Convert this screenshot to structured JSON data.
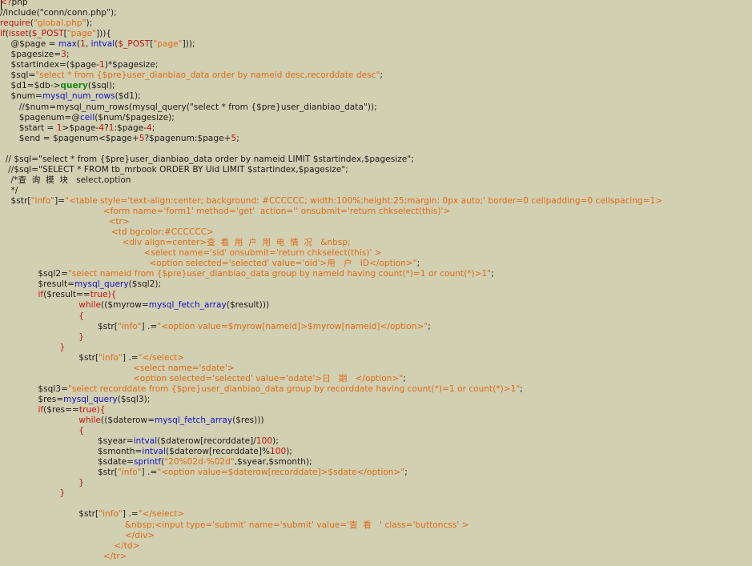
{
  "editor": {
    "background_color": "#d2d0b2",
    "colors": {
      "keyword": "#c81010",
      "function": "#1010c8",
      "string": "#e06a14",
      "plain": "#1a1a1a",
      "method": "#168a16"
    },
    "lines": [
      [
        {
          "t": "<?",
          "c": "phptag"
        },
        {
          "t": "php",
          "c": "plain"
        }
      ],
      [
        {
          "t": "//include(\"conn/conn.php\");",
          "c": "plain"
        }
      ],
      [
        {
          "t": "require",
          "c": "kw"
        },
        {
          "t": "(",
          "c": "plain"
        },
        {
          "t": "\"global.php\"",
          "c": "str"
        },
        {
          "t": ");",
          "c": "plain"
        }
      ],
      [
        {
          "t": "if",
          "c": "kw"
        },
        {
          "t": "(",
          "c": "plain"
        },
        {
          "t": "isset",
          "c": "kw"
        },
        {
          "t": "(",
          "c": "plain"
        },
        {
          "t": "$_POST",
          "c": "kw"
        },
        {
          "t": "[",
          "c": "plain"
        },
        {
          "t": "\"page\"",
          "c": "str"
        },
        {
          "t": "])){",
          "c": "plain"
        }
      ],
      [
        {
          "t": "    @$page = ",
          "c": "plain"
        },
        {
          "t": "max",
          "c": "fn"
        },
        {
          "t": "(",
          "c": "plain"
        },
        {
          "t": "1",
          "c": "num"
        },
        {
          "t": ", ",
          "c": "plain"
        },
        {
          "t": "intval",
          "c": "fn"
        },
        {
          "t": "(",
          "c": "plain"
        },
        {
          "t": "$_POST",
          "c": "kw"
        },
        {
          "t": "[",
          "c": "plain"
        },
        {
          "t": "\"page\"",
          "c": "str"
        },
        {
          "t": "]));",
          "c": "plain"
        }
      ],
      [
        {
          "t": "    $pagesize=",
          "c": "plain"
        },
        {
          "t": "3",
          "c": "num"
        },
        {
          "t": ";",
          "c": "plain"
        }
      ],
      [
        {
          "t": "    $startindex=($page-",
          "c": "plain"
        },
        {
          "t": "1",
          "c": "num"
        },
        {
          "t": ")*$pagesize;",
          "c": "plain"
        }
      ],
      [
        {
          "t": "    $sql=",
          "c": "plain"
        },
        {
          "t": "\"select * from {$pre}user_dianbiao_data order by nameid desc,recorddate desc\"",
          "c": "str"
        },
        {
          "t": ";",
          "c": "plain"
        }
      ],
      [
        {
          "t": "    $d1=$db->",
          "c": "plain"
        },
        {
          "t": "query",
          "c": "method"
        },
        {
          "t": "($sql);",
          "c": "plain"
        }
      ],
      [
        {
          "t": "    $num=",
          "c": "plain"
        },
        {
          "t": "mysql_num_rows",
          "c": "fn"
        },
        {
          "t": "($d1);",
          "c": "plain"
        }
      ],
      [
        {
          "t": "       //$num=mysql_num_rows(mysql_query(\"select * from {$pre}user_dianbiao_data\"));",
          "c": "plain"
        }
      ],
      [
        {
          "t": "       $pagenum=@",
          "c": "plain"
        },
        {
          "t": "ceil",
          "c": "fn"
        },
        {
          "t": "($num/$pagesize);",
          "c": "plain"
        }
      ],
      [
        {
          "t": "       $start = ",
          "c": "plain"
        },
        {
          "t": "1",
          "c": "num"
        },
        {
          "t": ">$page-",
          "c": "plain"
        },
        {
          "t": "4",
          "c": "num"
        },
        {
          "t": "?",
          "c": "plain"
        },
        {
          "t": "1",
          "c": "num"
        },
        {
          "t": ":$page-",
          "c": "plain"
        },
        {
          "t": "4",
          "c": "num"
        },
        {
          "t": ";",
          "c": "plain"
        }
      ],
      [
        {
          "t": "       $end = $pagenum<$page+",
          "c": "plain"
        },
        {
          "t": "5",
          "c": "num"
        },
        {
          "t": "?$pagenum:$page+",
          "c": "plain"
        },
        {
          "t": "5",
          "c": "num"
        },
        {
          "t": ";",
          "c": "plain"
        }
      ],
      [
        {
          "t": "",
          "c": "plain"
        }
      ],
      [
        {
          "t": "  // $sql=\"select * from {$pre}user_dianbiao_data order by nameid LIMIT $startindex,$pagesize\";",
          "c": "plain"
        }
      ],
      [
        {
          "t": "   //$sql=\"SELECT * FROM tb_mrbook ORDER BY Uid LIMIT $startindex,$pagesize\";",
          "c": "plain"
        }
      ],
      [
        {
          "t": "    /*查  询  模  块   select,option",
          "c": "plain"
        }
      ],
      [
        {
          "t": "    */",
          "c": "plain"
        }
      ],
      [
        {
          "t": "    $str[",
          "c": "plain"
        },
        {
          "t": "\"info\"",
          "c": "str"
        },
        {
          "t": "]=",
          "c": "plain"
        },
        {
          "t": "\"<table style='text-align:center; background: #CCCCCC; width:100%;height:25;margin: 0px auto;' border=0 cellpadding=0 cellspacing=1>",
          "c": "str"
        }
      ],
      [
        {
          "t": "                                      <form name='form1' method='get'  action='' onsubmit='return chkselect(this)'>",
          "c": "str"
        }
      ],
      [
        {
          "t": "                                        <tr>",
          "c": "str"
        }
      ],
      [
        {
          "t": "                                         <td bgcolor:#CCCCCC>",
          "c": "str"
        }
      ],
      [
        {
          "t": "                                             <div align=center>查  看  用  户  用  电  情  况   &nbsp;",
          "c": "str"
        }
      ],
      [
        {
          "t": "                                                     <select name='sid' onsubmit='return chkselect(this)' >",
          "c": "str"
        }
      ],
      [
        {
          "t": "                                                       <option selected='selected' value='oid'>用   户   ID</option>\"",
          "c": "str"
        },
        {
          "t": ";",
          "c": "plain"
        }
      ],
      [
        {
          "t": "              $sql2=",
          "c": "plain"
        },
        {
          "t": "\"select nameid from {$pre}user_dianbiao_data group by nameid having count(*)=1 or count(*)>1\"",
          "c": "str"
        },
        {
          "t": ";",
          "c": "plain"
        }
      ],
      [
        {
          "t": "              $result=",
          "c": "plain"
        },
        {
          "t": "mysql_query",
          "c": "fn"
        },
        {
          "t": "($sql2);",
          "c": "plain"
        }
      ],
      [
        {
          "t": "              ",
          "c": "plain"
        },
        {
          "t": "if",
          "c": "kw"
        },
        {
          "t": "($result==",
          "c": "plain"
        },
        {
          "t": "true",
          "c": "kw"
        },
        {
          "t": "){",
          "c": "kw"
        }
      ],
      [
        {
          "t": "                             ",
          "c": "plain"
        },
        {
          "t": "while",
          "c": "kw"
        },
        {
          "t": "((",
          "c": "plain"
        },
        {
          "t": "$myrow=",
          "c": "plain"
        },
        {
          "t": "mysql_fetch_array",
          "c": "fn"
        },
        {
          "t": "($result)))",
          "c": "plain"
        }
      ],
      [
        {
          "t": "                             {",
          "c": "kw"
        }
      ],
      [
        {
          "t": "                                    $str[",
          "c": "plain"
        },
        {
          "t": "\"info\"",
          "c": "str"
        },
        {
          "t": "] .=",
          "c": "plain"
        },
        {
          "t": "\"<option value=$myrow[nameid]>$myrow[nameid]</option>\"",
          "c": "str"
        },
        {
          "t": ";",
          "c": "plain"
        }
      ],
      [
        {
          "t": "                             }",
          "c": "kw"
        }
      ],
      [
        {
          "t": "                      }",
          "c": "kw"
        }
      ],
      [
        {
          "t": "                             $str[",
          "c": "plain"
        },
        {
          "t": "\"info\"",
          "c": "str"
        },
        {
          "t": "] .=",
          "c": "plain"
        },
        {
          "t": "\"</select>",
          "c": "str"
        }
      ],
      [
        {
          "t": "                                                 <select name='sdate'>",
          "c": "str"
        }
      ],
      [
        {
          "t": "                                                 <option selected='selected' value='odate'>日   期   </option>\"",
          "c": "str"
        },
        {
          "t": ";",
          "c": "plain"
        }
      ],
      [
        {
          "t": "              $sql3=",
          "c": "plain"
        },
        {
          "t": "\"select recorddate from {$pre}user_dianbiao_data group by recorddate having count(*)=1 or count(*)>1\"",
          "c": "str"
        },
        {
          "t": ";",
          "c": "plain"
        }
      ],
      [
        {
          "t": "              $res=",
          "c": "plain"
        },
        {
          "t": "mysql_query",
          "c": "fn"
        },
        {
          "t": "($sql3);",
          "c": "plain"
        }
      ],
      [
        {
          "t": "              ",
          "c": "plain"
        },
        {
          "t": "if",
          "c": "kw"
        },
        {
          "t": "($res==",
          "c": "plain"
        },
        {
          "t": "true",
          "c": "kw"
        },
        {
          "t": "){",
          "c": "kw"
        }
      ],
      [
        {
          "t": "                             ",
          "c": "plain"
        },
        {
          "t": "while",
          "c": "kw"
        },
        {
          "t": "((",
          "c": "plain"
        },
        {
          "t": "$daterow=",
          "c": "plain"
        },
        {
          "t": "mysql_fetch_array",
          "c": "fn"
        },
        {
          "t": "($res)))",
          "c": "plain"
        }
      ],
      [
        {
          "t": "                             {",
          "c": "kw"
        }
      ],
      [
        {
          "t": "                                    $syear=",
          "c": "plain"
        },
        {
          "t": "intval",
          "c": "fn"
        },
        {
          "t": "($daterow[recorddate]/",
          "c": "plain"
        },
        {
          "t": "100",
          "c": "num"
        },
        {
          "t": ");",
          "c": "plain"
        }
      ],
      [
        {
          "t": "                                    $smonth=",
          "c": "plain"
        },
        {
          "t": "intval",
          "c": "fn"
        },
        {
          "t": "($daterow[recorddate]%",
          "c": "plain"
        },
        {
          "t": "100",
          "c": "num"
        },
        {
          "t": ");",
          "c": "plain"
        }
      ],
      [
        {
          "t": "                                    $sdate=",
          "c": "plain"
        },
        {
          "t": "sprintf",
          "c": "fn"
        },
        {
          "t": "(",
          "c": "plain"
        },
        {
          "t": "\"20%02d-%02d\"",
          "c": "str"
        },
        {
          "t": ",$syear,$smonth);",
          "c": "plain"
        }
      ],
      [
        {
          "t": "                                    $str[",
          "c": "plain"
        },
        {
          "t": "\"info\"",
          "c": "str"
        },
        {
          "t": "] .=",
          "c": "plain"
        },
        {
          "t": "\"<option value=$daterow[recorddate]>$sdate</option>\"",
          "c": "str"
        },
        {
          "t": ";",
          "c": "plain"
        }
      ],
      [
        {
          "t": "                             }",
          "c": "kw"
        }
      ],
      [
        {
          "t": "                      }",
          "c": "kw"
        }
      ],
      [
        {
          "t": "",
          "c": "plain"
        }
      ],
      [
        {
          "t": "                             $str[",
          "c": "plain"
        },
        {
          "t": "\"info\"",
          "c": "str"
        },
        {
          "t": "] .=",
          "c": "plain"
        },
        {
          "t": "\"</select>",
          "c": "str"
        }
      ],
      [
        {
          "t": "                                              &nbsp;<input type='submit' name='submit' value='查  看   ' class='buttoncss' >",
          "c": "str"
        }
      ],
      [
        {
          "t": "                                              </div>",
          "c": "str"
        }
      ],
      [
        {
          "t": "                                          </td>",
          "c": "str"
        }
      ],
      [
        {
          "t": "                                      </tr>",
          "c": "str"
        }
      ]
    ]
  }
}
